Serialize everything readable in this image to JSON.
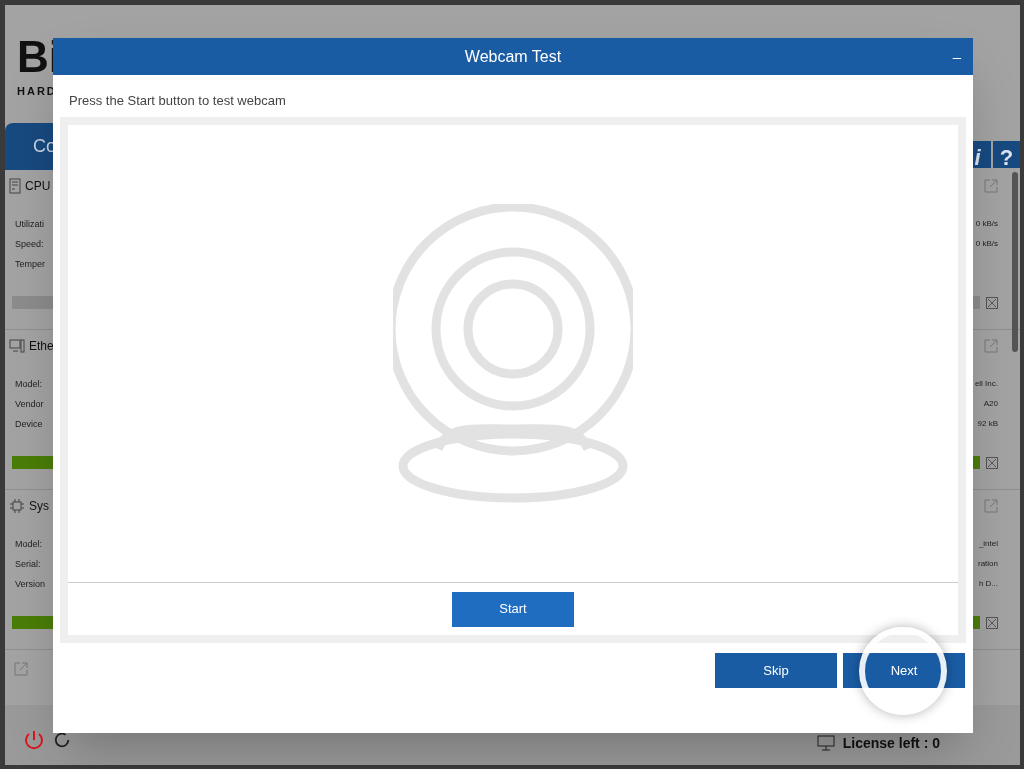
{
  "app": {
    "logo": "Bi",
    "logo_subtitle": "HARD",
    "tab": "Co",
    "header_buttons": [
      "i",
      "?"
    ],
    "panels": [
      {
        "kind": "cpu",
        "title": "CPU",
        "labels": [
          "Utilizati",
          "Speed:",
          "Temper"
        ],
        "values": [
          "0 kB/s",
          "0 kB/s"
        ],
        "level": 0
      },
      {
        "kind": "ethernet",
        "title": "Ethe",
        "labels": [
          "Model:",
          "Vendor",
          "Device"
        ],
        "values": [
          "ell Inc.",
          "A20",
          "92 kB"
        ],
        "level": 1
      },
      {
        "kind": "system",
        "title": "Sys",
        "labels": [
          "Model:",
          "Serial:",
          "Version"
        ],
        "values": [
          "_intel",
          "ration",
          "h D..."
        ],
        "level": 1
      }
    ],
    "license": "License left : 0"
  },
  "dialog": {
    "title": "Webcam Test",
    "minimize": "–",
    "instruction": "Press the Start button to test webcam",
    "start_button": "Start",
    "buttons": [
      {
        "label": "Skip",
        "focused": false
      },
      {
        "label": "Next",
        "focused": true
      }
    ]
  }
}
